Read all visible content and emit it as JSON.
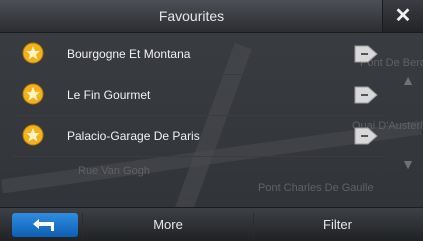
{
  "header": {
    "title": "Favourites"
  },
  "favourites": [
    {
      "label": "Bourgogne Et Montana"
    },
    {
      "label": "Le Fin Gourmet"
    },
    {
      "label": "Palacio-Garage De Paris"
    }
  ],
  "map_labels": {
    "street_1": "Rue Van Gogh",
    "street_2": "Pont Charles De Gaulle",
    "street_3": "Quai D'Austerlitz",
    "street_4": "Pont De Bercy"
  },
  "footer": {
    "more_label": "More",
    "filter_label": "Filter"
  },
  "colors": {
    "accent": "#1f78d1",
    "star": "#f3b21c",
    "background": "#34373c"
  },
  "icons": {
    "close": "close-icon",
    "favourite": "star-icon",
    "go": "arrow-right-icon",
    "scroll_up": "scroll-up-icon",
    "scroll_down": "scroll-down-icon",
    "back": "back-arrow-icon"
  }
}
